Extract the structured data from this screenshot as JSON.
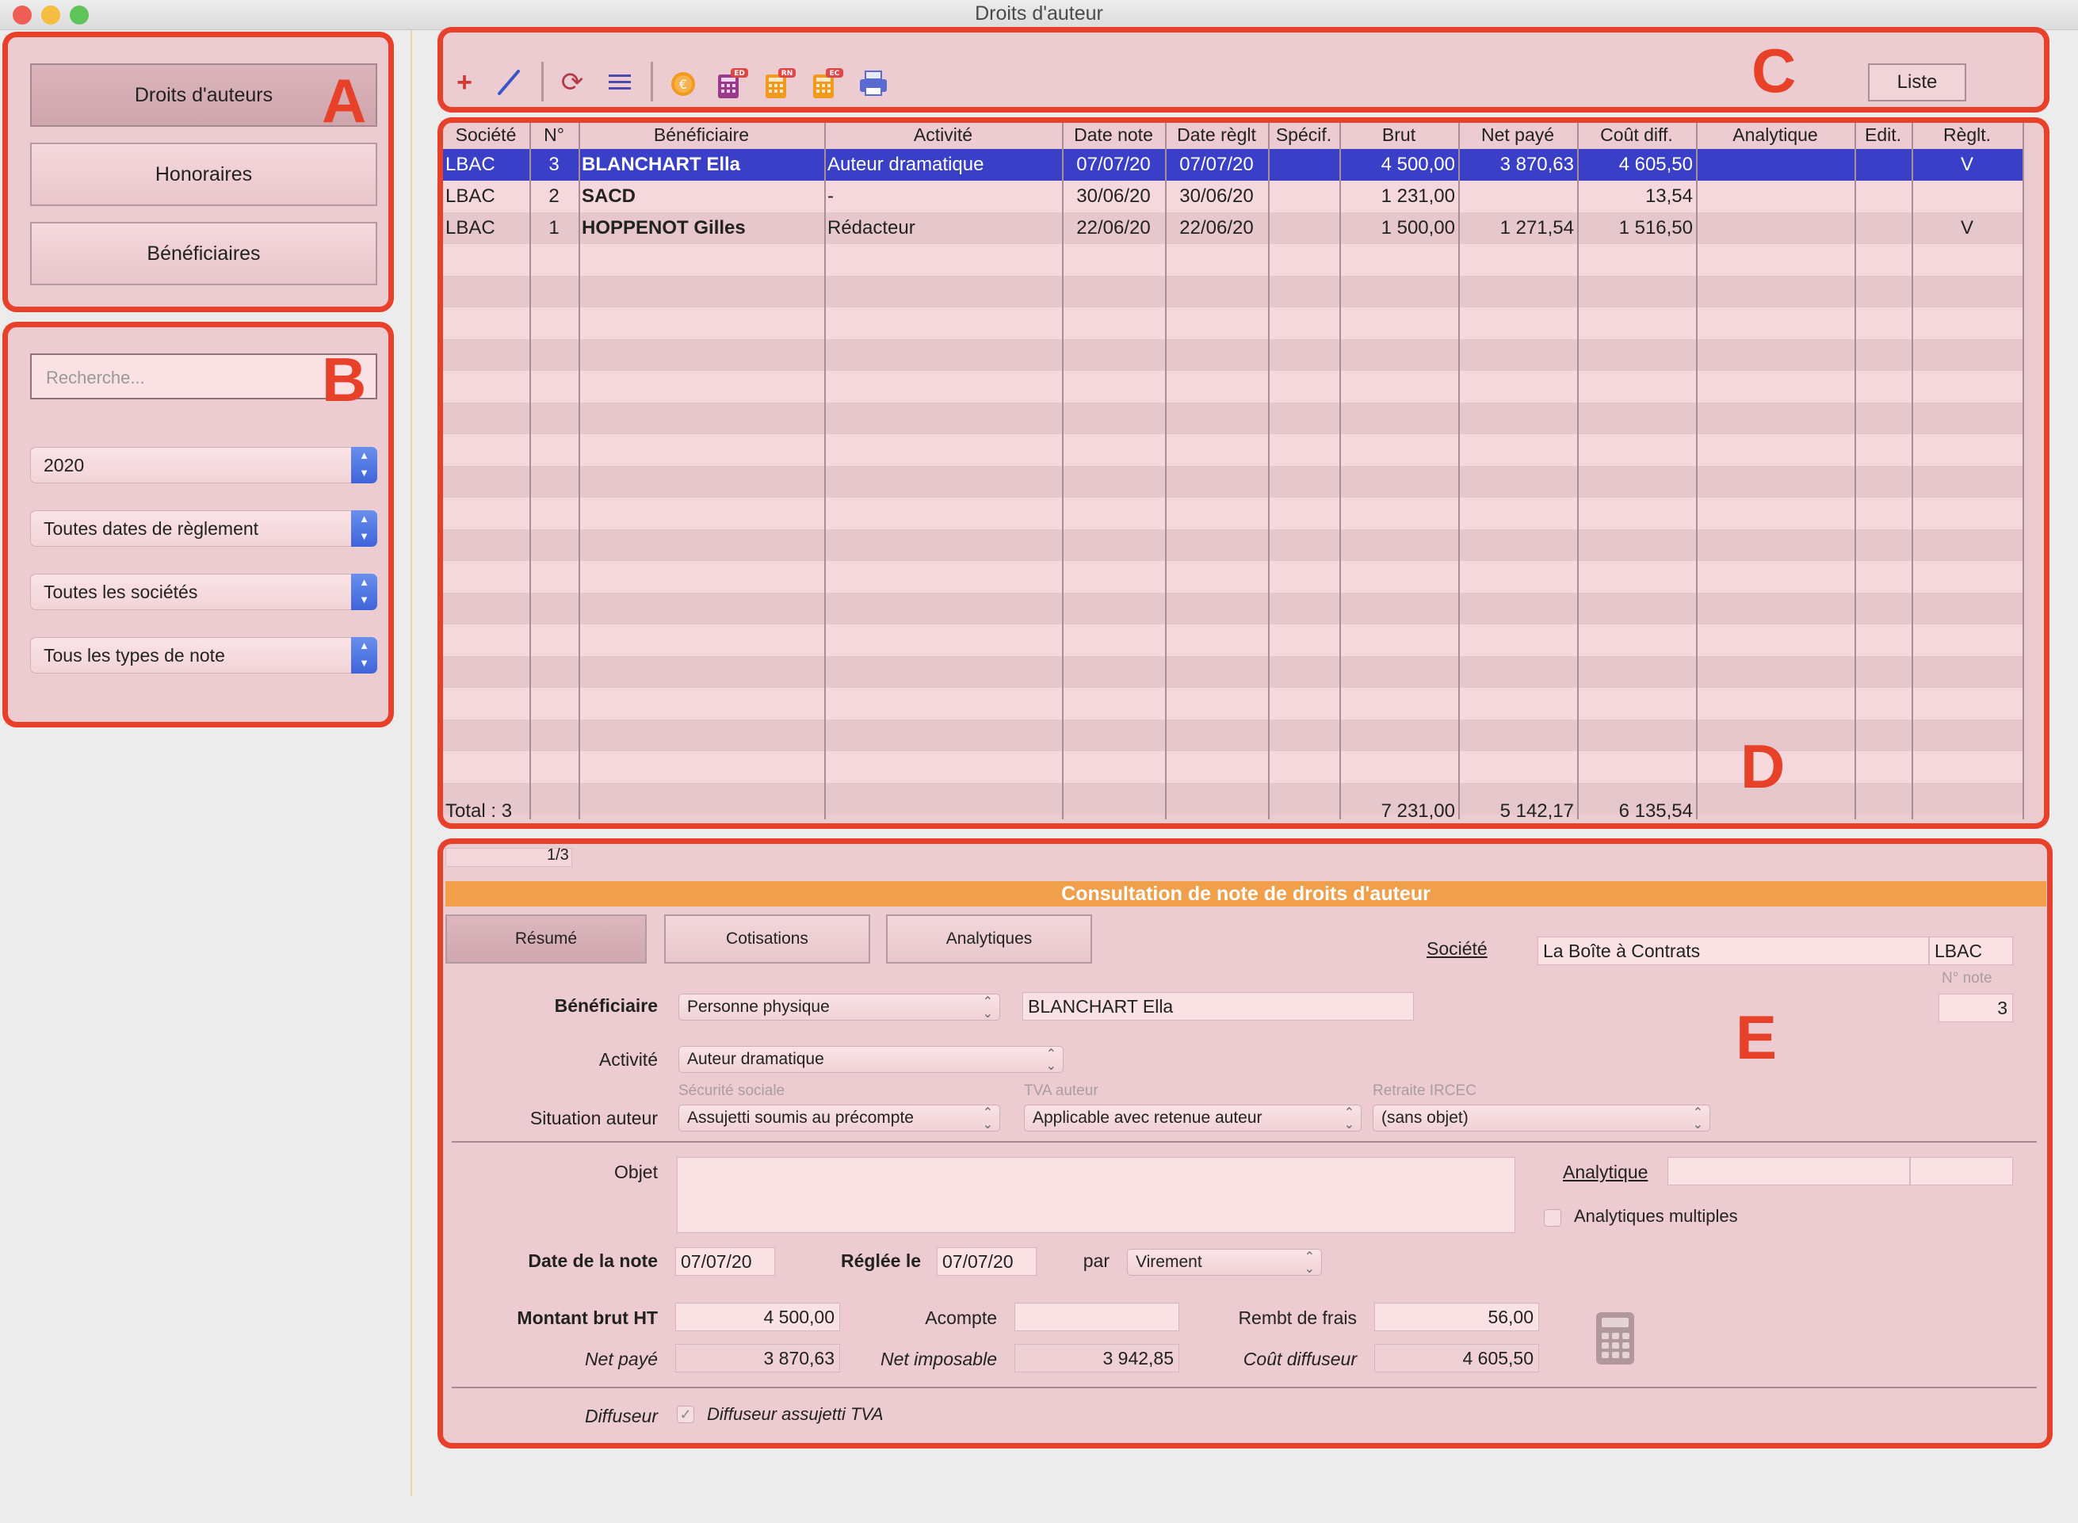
{
  "window": {
    "title": "Droits d'auteur"
  },
  "sidebar": {
    "nav": [
      {
        "label": "Droits d'auteurs",
        "active": true
      },
      {
        "label": "Honoraires",
        "active": false
      },
      {
        "label": "Bénéficiaires",
        "active": false
      }
    ],
    "search_placeholder": "Recherche...",
    "filters": [
      "2020",
      "Toutes dates de règlement",
      "Toutes les sociétés",
      "Tous les types de note"
    ]
  },
  "annotations": {
    "a": "A",
    "b": "B",
    "c": "C",
    "d": "D",
    "e": "E"
  },
  "toolbar": {
    "icons": [
      "add-icon",
      "edit-pen-icon",
      "refresh-icon",
      "list-lines-icon",
      "euro-coins-icon",
      "calc-ed-icon",
      "calc-rn-icon",
      "calc-ec-icon",
      "printer-icon"
    ],
    "badges": {
      "ed": "ED",
      "rn": "RN",
      "ec": "EC"
    },
    "liste_label": "Liste"
  },
  "table": {
    "columns": [
      "Société",
      "N°",
      "Bénéficiaire",
      "Activité",
      "Date note",
      "Date règlt",
      "Spécif.",
      "Brut",
      "Net payé",
      "Coût diff.",
      "Analytique",
      "Edit.",
      "Règlt."
    ],
    "rows": [
      {
        "societe": "LBAC",
        "no": "3",
        "beneficiaire": "BLANCHART Ella",
        "activite": "Auteur dramatique",
        "date_note": "07/07/20",
        "date_reglt": "07/07/20",
        "specif": "",
        "brut": "4 500,00",
        "net_paye": "3 870,63",
        "cout_diff": "4 605,50",
        "analytique": "",
        "edit": "",
        "reglt": "V",
        "selected": true
      },
      {
        "societe": "LBAC",
        "no": "2",
        "beneficiaire": "SACD",
        "activite": "-",
        "date_note": "30/06/20",
        "date_reglt": "30/06/20",
        "specif": "",
        "brut": "1 231,00",
        "net_paye": "",
        "cout_diff": "13,54",
        "analytique": "",
        "edit": "",
        "reglt": "",
        "selected": false
      },
      {
        "societe": "LBAC",
        "no": "1",
        "beneficiaire": "HOPPENOT Gilles",
        "activite": "Rédacteur",
        "date_note": "22/06/20",
        "date_reglt": "22/06/20",
        "specif": "",
        "brut": "1 500,00",
        "net_paye": "1 271,54",
        "cout_diff": "1 516,50",
        "analytique": "",
        "edit": "",
        "reglt": "V",
        "selected": false
      }
    ],
    "total_label": "Total : 3",
    "total_brut": "7 231,00",
    "total_net": "5 142,17",
    "total_cout": "6 135,54"
  },
  "detail": {
    "pager": "1/3",
    "header": "Consultation de note de droits d'auteur",
    "header_color": "#f0a04a",
    "tabs": [
      {
        "label": "Résumé",
        "active": true
      },
      {
        "label": "Cotisations",
        "active": false
      },
      {
        "label": "Analytiques",
        "active": false
      }
    ],
    "societe_label": "Société",
    "societe_name": "La Boîte à Contrats",
    "societe_code": "LBAC",
    "no_note_label": "N° note",
    "no_note": "3",
    "beneficiaire_label": "Bénéficiaire",
    "beneficiaire_type": "Personne physique",
    "beneficiaire_name": "BLANCHART Ella",
    "activite_label": "Activité",
    "activite": "Auteur dramatique",
    "secu_label": "Sécurité sociale",
    "tva_label": "TVA auteur",
    "retraite_label": "Retraite IRCEC",
    "situation_label": "Situation auteur",
    "secu": "Assujetti soumis au précompte",
    "tva": "Applicable avec retenue auteur",
    "retraite": "(sans objet)",
    "objet_label": "Objet",
    "objet": "",
    "analytique_label": "Analytique",
    "analytiques_multiples_label": "Analytiques multiples",
    "date_note_label": "Date de la note",
    "date_note": "07/07/20",
    "reglee_label": "Réglée le",
    "reglee": "07/07/20",
    "par_label": "par",
    "par": "Virement",
    "montant_label": "Montant brut HT",
    "montant": "4 500,00",
    "acompte_label": "Acompte",
    "acompte": "",
    "rembt_label": "Rembt de frais",
    "rembt": "56,00",
    "net_paye_label": "Net payé",
    "net_paye": "3 870,63",
    "net_imposable_label": "Net imposable",
    "net_imposable": "3 942,85",
    "cout_label": "Coût diffuseur",
    "cout": "4 605,50",
    "diffuseur_label": "Diffuseur",
    "diffuseur_tva_label": "Diffuseur assujetti TVA",
    "diffuseur_tva_checked": true
  },
  "colors": {
    "accent_red": "#e8412a",
    "selection_blue": "#3a3fc8",
    "panel_pink": "#ecccd0"
  }
}
